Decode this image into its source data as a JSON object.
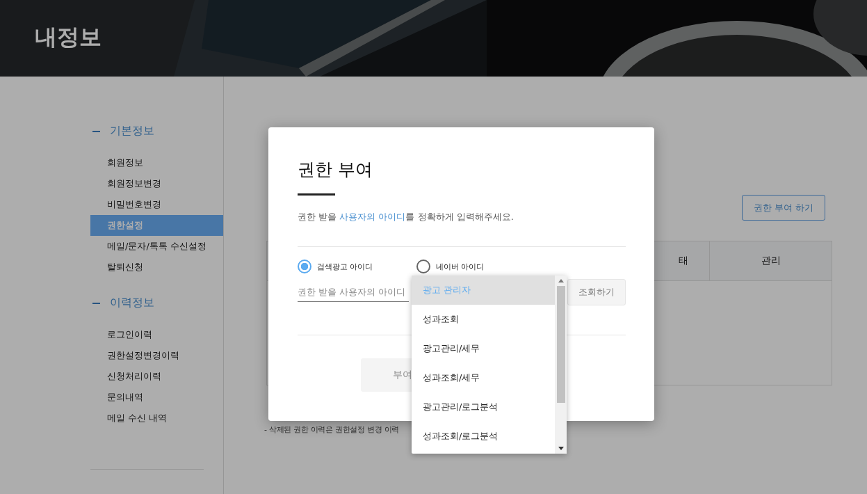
{
  "header": {
    "title": "내정보"
  },
  "sidebar": {
    "groups": [
      {
        "title": "기본정보",
        "items": [
          {
            "label": "회원정보",
            "selected": false
          },
          {
            "label": "회원정보변경",
            "selected": false
          },
          {
            "label": "비밀번호변경",
            "selected": false
          },
          {
            "label": "권한설정",
            "selected": true
          },
          {
            "label": "메일/문자/톡톡 수신설정",
            "selected": false
          },
          {
            "label": "탈퇴신청",
            "selected": false
          }
        ]
      },
      {
        "title": "이력정보",
        "items": [
          {
            "label": "로그인이력",
            "selected": false
          },
          {
            "label": "권한설정변경이력",
            "selected": false
          },
          {
            "label": "신청처리이력",
            "selected": false
          },
          {
            "label": "문의내역",
            "selected": false
          },
          {
            "label": "메일 수신 내역",
            "selected": false
          }
        ]
      }
    ]
  },
  "content": {
    "grant_button": "권한 부여 하기",
    "table": {
      "columns": [
        "태",
        "관리"
      ]
    },
    "note": "- 삭제된 권한 이력은 권한설정 변경 이력"
  },
  "modal": {
    "title": "권한 부여",
    "description": [
      {
        "text": "권한 받을 ",
        "highlight": false
      },
      {
        "text": "사용자의 아이디",
        "highlight": true
      },
      {
        "text": "를 정확하게 입력해주세요.",
        "highlight": false
      }
    ],
    "radios": [
      {
        "label": "검색광고 아이디",
        "selected": true
      },
      {
        "label": "네이버 아이디",
        "selected": false
      }
    ],
    "id_field": {
      "placeholder": "권한 받을 사용자의 아이디"
    },
    "lookup_button": "조회하기",
    "submit_button": "부여"
  },
  "dropdown": {
    "options": [
      {
        "label": "광고 관리자",
        "selected": true
      },
      {
        "label": "성과조회",
        "selected": false
      },
      {
        "label": "광고관리/세무",
        "selected": false
      },
      {
        "label": "성과조회/세무",
        "selected": false
      },
      {
        "label": "광고관리/로그분석",
        "selected": false
      },
      {
        "label": "성과조회/로그분석",
        "selected": false
      }
    ]
  }
}
